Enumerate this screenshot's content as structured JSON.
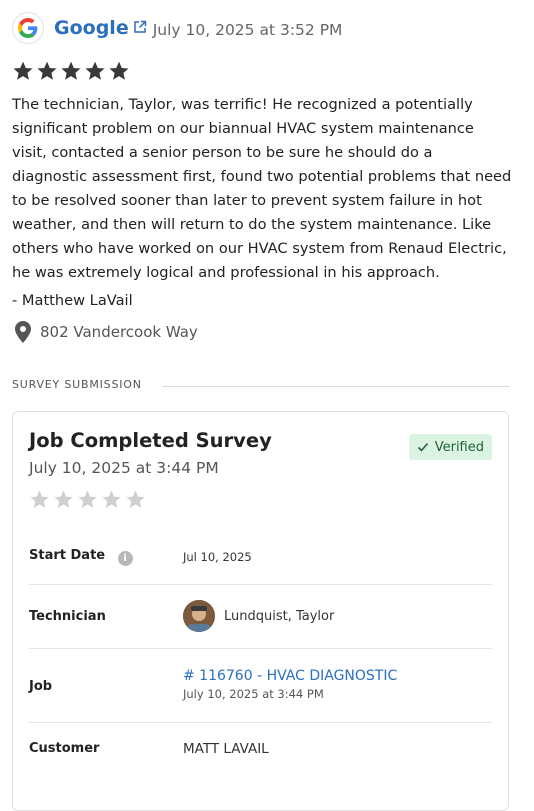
{
  "review": {
    "source": "Google",
    "date": "July 10, 2025 at 3:52 PM",
    "rating": 5,
    "text": "The technician, Taylor, was terrific!  He recognized a potentially significant problem on our biannual HVAC system maintenance visit, contacted a senior person to be sure he should do a diagnostic assessment first, found two potential problems that need to be resolved sooner than later to prevent system failure in hot weather, and then will return to do the system maintenance. Like others who have worked on our HVAC system from Renaud Electric, he was extremely logical and professional in his approach.",
    "author": "- Matthew LaVail",
    "location": "802 Vandercook Way"
  },
  "survey": {
    "section_label": "SURVEY SUBMISSION",
    "title": "Job Completed Survey",
    "date": "July 10, 2025 at 3:44 PM",
    "status": "Verified",
    "rating": 0,
    "fields": {
      "start_date_label": "Start Date",
      "start_date_value": "Jul 10, 2025",
      "technician_label": "Technician",
      "technician_value": "Lundquist, Taylor",
      "job_label": "Job",
      "job_link": "# 116760 - HVAC DIAGNOSTIC",
      "job_date": "July 10, 2025 at 3:44 PM",
      "customer_label": "Customer",
      "customer_value": "MATT LAVAIL"
    }
  },
  "colors": {
    "link": "#2a6fbd",
    "star_filled": "#3a3a3a",
    "star_empty": "#cfcfcf",
    "verified_bg": "#daf3e3",
    "verified_text": "#23613a"
  },
  "icons": [
    "google-logo",
    "external-link-icon",
    "star-icon",
    "location-pin-icon",
    "check-icon",
    "info-icon",
    "avatar"
  ]
}
